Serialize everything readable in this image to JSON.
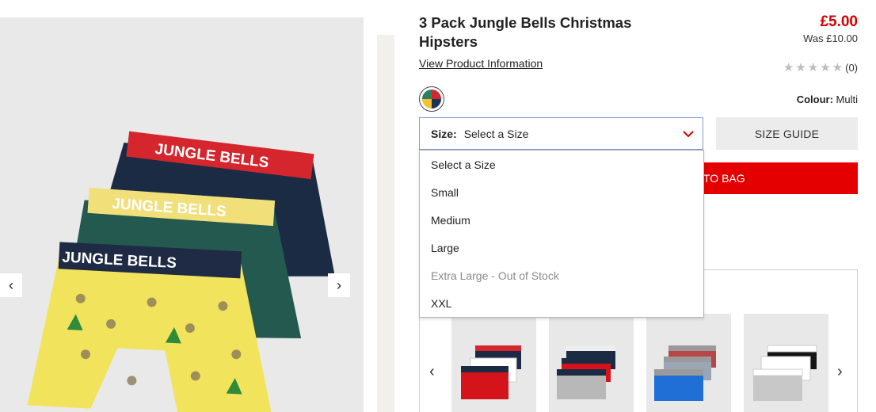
{
  "product": {
    "title": "3 Pack Jungle Bells Christmas Hipsters",
    "view_info_link": "View Product Information",
    "price": "£5.00",
    "was_price": "Was £10.00",
    "rating_count": "(0)",
    "rating_stars": 0,
    "colour_label": "Colour:",
    "colour_value": "Multi",
    "image_waistband_text": "JUNGLE BELLS"
  },
  "size_selector": {
    "label": "Size:",
    "value": "Select a Size",
    "options": [
      {
        "label": "Select a Size",
        "enabled": true
      },
      {
        "label": "Small",
        "enabled": true
      },
      {
        "label": "Medium",
        "enabled": true
      },
      {
        "label": "Large",
        "enabled": true
      },
      {
        "label": "Extra Large - Out of Stock",
        "enabled": false
      },
      {
        "label": "XXL",
        "enabled": true
      }
    ]
  },
  "buttons": {
    "size_guide": "SIZE GUIDE",
    "add_to_bag_visible": "TO BAG"
  },
  "icons": {
    "gallery_prev": "chevron-left-icon",
    "gallery_next": "chevron-right-icon",
    "select_chevron": "chevron-down-icon",
    "rating": "star-icon"
  },
  "colors": {
    "price_red": "#d40000",
    "button_red": "#e50000",
    "select_border": "#7f9ccf",
    "star_grey": "#bdbdbd"
  }
}
